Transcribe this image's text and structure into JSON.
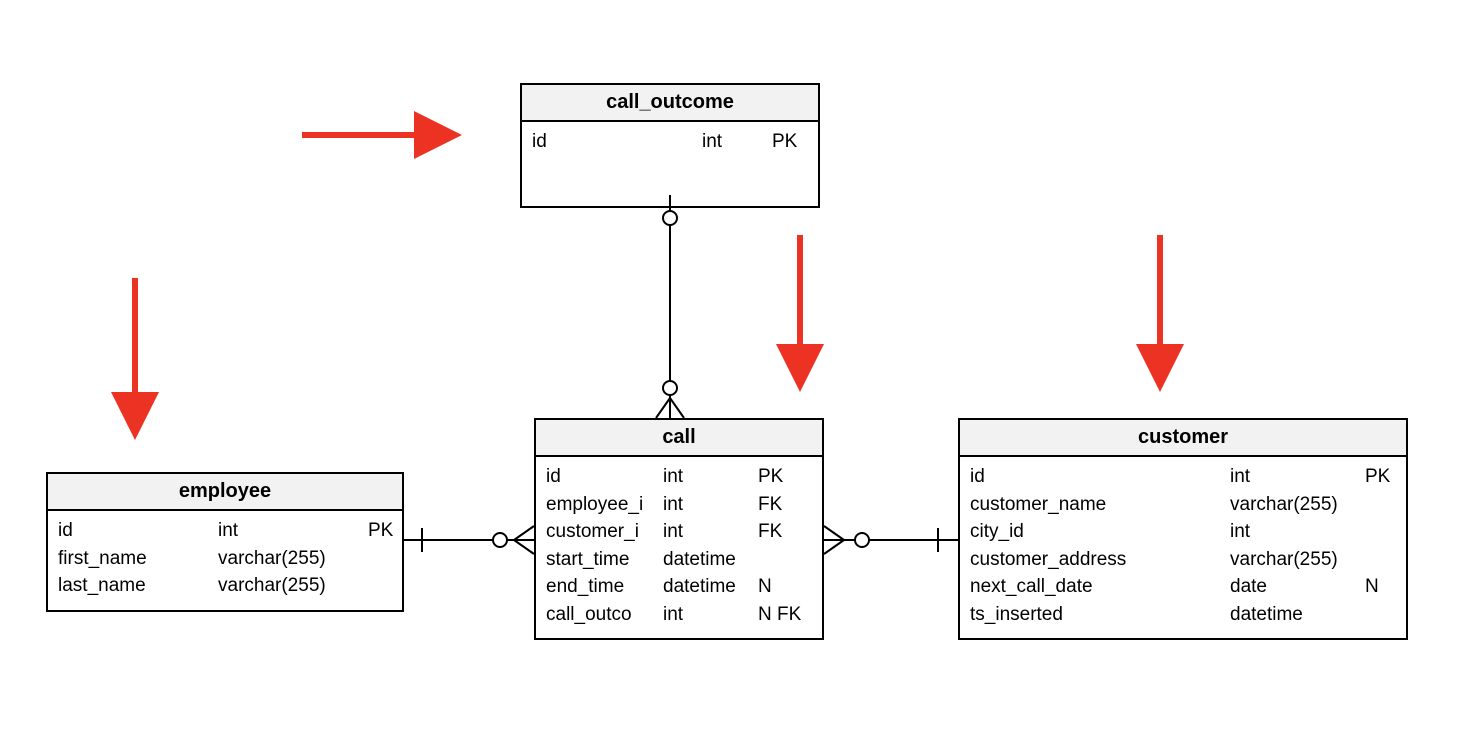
{
  "entities": {
    "call_outcome": {
      "title": "call_outcome",
      "rows": [
        {
          "name": "id",
          "type": "int",
          "key": "PK"
        }
      ]
    },
    "employee": {
      "title": "employee",
      "rows": [
        {
          "name": "id",
          "type": "int",
          "key": "PK"
        },
        {
          "name": "first_name",
          "type": "varchar(255)",
          "key": ""
        },
        {
          "name": "last_name",
          "type": "varchar(255)",
          "key": ""
        }
      ]
    },
    "call": {
      "title": "call",
      "rows": [
        {
          "name": "id",
          "type": "int",
          "key": "PK"
        },
        {
          "name": "employee_i",
          "type": "int",
          "key": "FK"
        },
        {
          "name": "customer_i",
          "type": "int",
          "key": "FK"
        },
        {
          "name": "start_time",
          "type": "datetime",
          "key": ""
        },
        {
          "name": "end_time",
          "type": "datetime",
          "key": "N"
        },
        {
          "name": "call_outco",
          "type": "int",
          "key": "N FK"
        }
      ]
    },
    "customer": {
      "title": "customer",
      "rows": [
        {
          "name": "id",
          "type": "int",
          "key": "PK"
        },
        {
          "name": "customer_name",
          "type": "varchar(255)",
          "key": ""
        },
        {
          "name": "city_id",
          "type": "int",
          "key": ""
        },
        {
          "name": "customer_address",
          "type": "varchar(255)",
          "key": ""
        },
        {
          "name": "next_call_date",
          "type": "date",
          "key": "N"
        },
        {
          "name": "ts_inserted",
          "type": "datetime",
          "key": ""
        }
      ]
    }
  },
  "colors": {
    "arrow": "#eb3223"
  }
}
